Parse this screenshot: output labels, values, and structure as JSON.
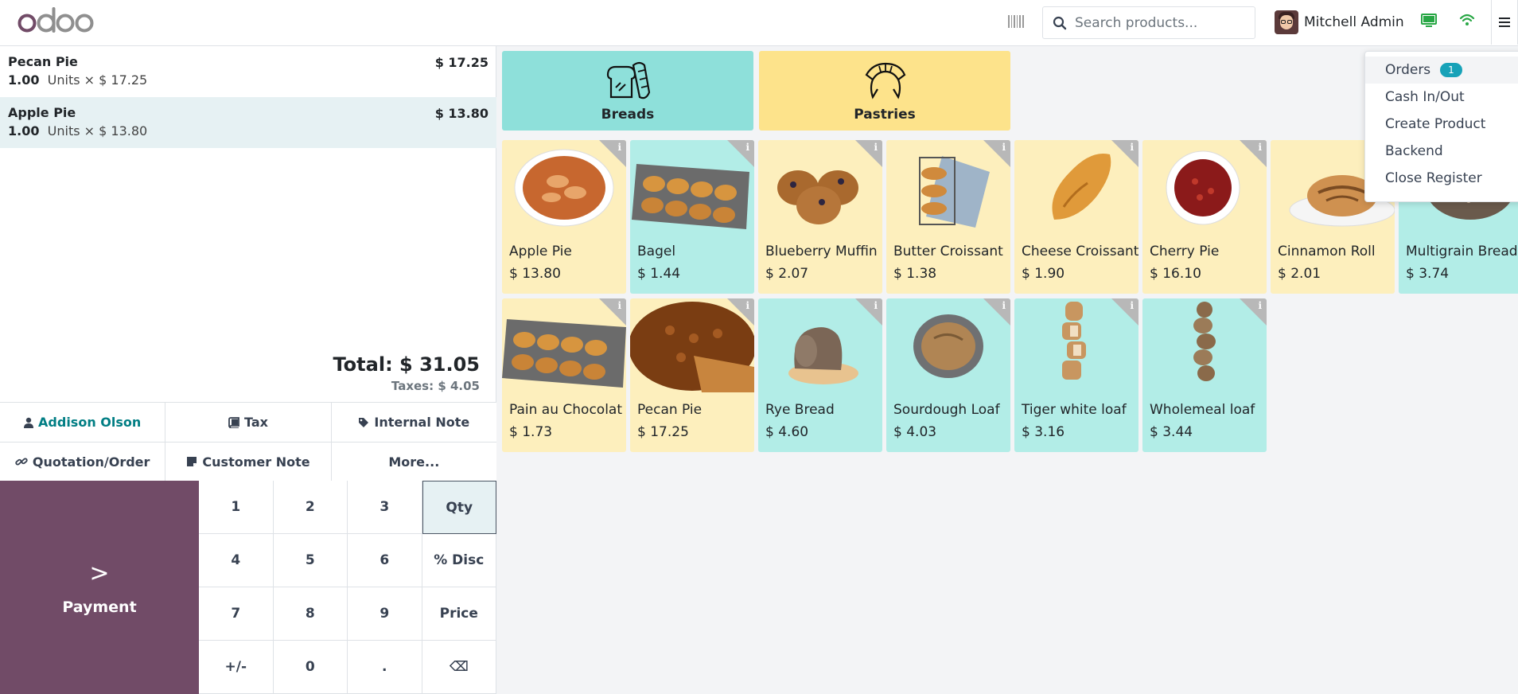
{
  "header": {
    "logo_text": "odoo",
    "search_placeholder": "Search products...",
    "user_name": "Mitchell Admin",
    "icons": [
      "barcode-icon",
      "search-icon",
      "monitor-icon",
      "wifi-icon",
      "hamburger-menu-icon"
    ]
  },
  "order": {
    "lines": [
      {
        "name": "Pecan Pie",
        "price": "$ 17.25",
        "qty": "1.00",
        "unit_detail": "Units × $ 17.25"
      },
      {
        "name": "Apple Pie",
        "price": "$ 13.80",
        "qty": "1.00",
        "unit_detail": "Units × $ 13.80"
      }
    ],
    "total": "Total: $ 31.05",
    "taxes": "Taxes: $ 4.05"
  },
  "controls": {
    "customer": "Addison Olson",
    "tax": "Tax",
    "internal_note": "Internal Note",
    "quotation": "Quotation/Order",
    "customer_note": "Customer Note",
    "more": "More..."
  },
  "payment": {
    "label": "Payment",
    "chevron": ">"
  },
  "numpad": [
    "1",
    "2",
    "3",
    "Qty",
    "4",
    "5",
    "6",
    "% Disc",
    "7",
    "8",
    "9",
    "Price",
    "+/-",
    "0",
    ".",
    "⌫"
  ],
  "categories": [
    {
      "label": "Breads",
      "color": "#8ee0da"
    },
    {
      "label": "Pastries",
      "color": "#fde38b"
    }
  ],
  "products": [
    {
      "name": "Apple Pie",
      "price": "$ 13.80"
    },
    {
      "name": "Bagel",
      "price": "$ 1.44"
    },
    {
      "name": "Blueberry Muffin",
      "price": "$ 2.07"
    },
    {
      "name": "Butter Croissant",
      "price": "$ 1.38"
    },
    {
      "name": "Cheese Croissant",
      "price": "$ 1.90"
    },
    {
      "name": "Cherry Pie",
      "price": "$ 16.10"
    },
    {
      "name": "Cinnamon Roll",
      "price": "$ 2.01"
    },
    {
      "name": "Multigrain Bread",
      "price": "$ 3.74"
    },
    {
      "name": "Pain au Chocolat",
      "price": "$ 1.73"
    },
    {
      "name": "Pecan Pie",
      "price": "$ 17.25"
    },
    {
      "name": "Rye Bread",
      "price": "$ 4.60"
    },
    {
      "name": "Sourdough Loaf",
      "price": "$ 4.03"
    },
    {
      "name": "Tiger white loaf",
      "price": "$ 3.16"
    },
    {
      "name": "Wholemeal loaf",
      "price": "$ 3.44"
    }
  ],
  "menu": {
    "items": [
      "Orders",
      "Cash In/Out",
      "Create Product",
      "Backend",
      "Close Register"
    ],
    "orders_badge": "1"
  },
  "colors": {
    "brand": "#714b67",
    "accent": "#017e84",
    "pastry_tile": "#fdefbd",
    "bread_tile": "#b2ede7"
  }
}
